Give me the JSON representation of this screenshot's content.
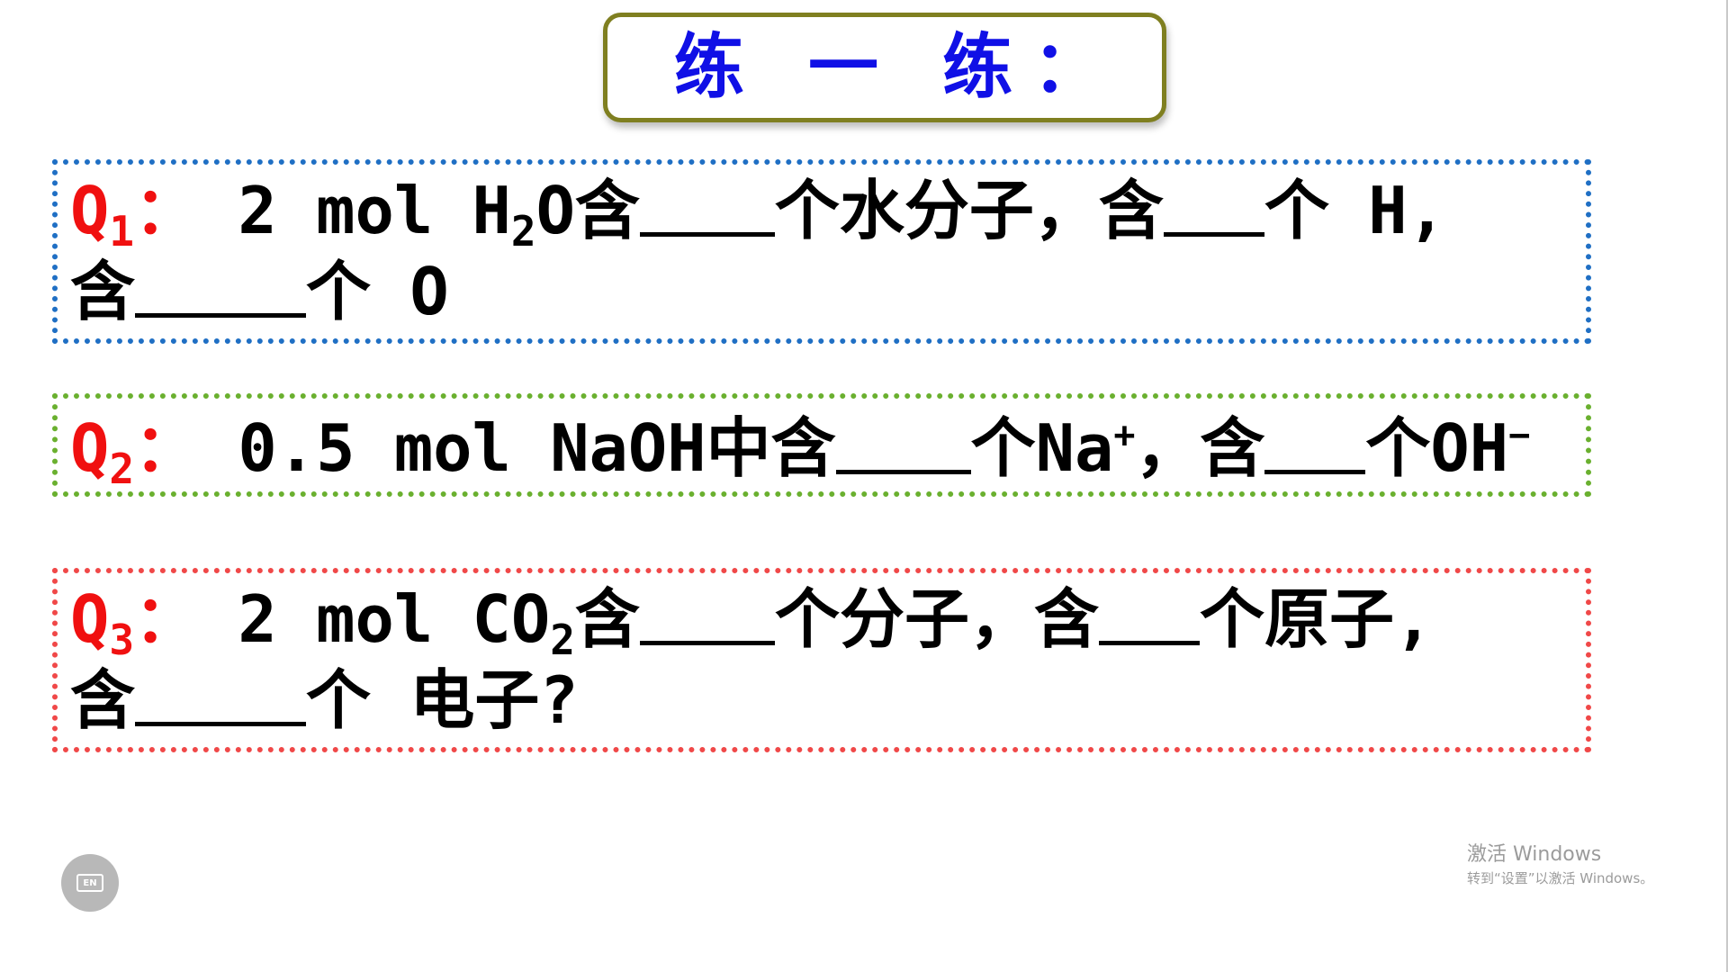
{
  "title": "练 一 练：",
  "questions": [
    {
      "label": "Q",
      "label_sub": "1",
      "colon": "：",
      "line1": {
        "t1": "  2 mol H",
        "sub1": "2",
        "t2": "O含",
        "t3": "个水分子，含",
        "t4": "个 H,"
      },
      "line2": {
        "t1": "含",
        "t2": "个 O"
      }
    },
    {
      "label": "Q",
      "label_sub": "2",
      "colon": "：",
      "line1": {
        "t1": "  0.5 mol NaOH中含",
        "t2": "个Na",
        "sup1": "+",
        "t3": "，含",
        "t4": "个OH",
        "sup2": "−"
      }
    },
    {
      "label": "Q",
      "label_sub": "3",
      "colon": "：",
      "line1": {
        "t1": "  2 mol CO",
        "sub1": "2",
        "t2": "含",
        "t3": "个分子，含",
        "t4": "个原子,"
      },
      "line2": {
        "t1": "含",
        "t2": "个 电子?"
      }
    }
  ],
  "ime_badge": {
    "label": "EN"
  },
  "activation": {
    "title": "激活 Windows",
    "subtitle": "转到“设置”以激活 Windows。"
  },
  "colors": {
    "title_text": "#1010e6",
    "title_border": "#7f7f20",
    "q1_border": "#1f6fc4",
    "q2_border": "#6ab02f",
    "q3_border": "#f04848",
    "q_label": "#f01010"
  },
  "icons": [
    "keyboard-icon"
  ]
}
